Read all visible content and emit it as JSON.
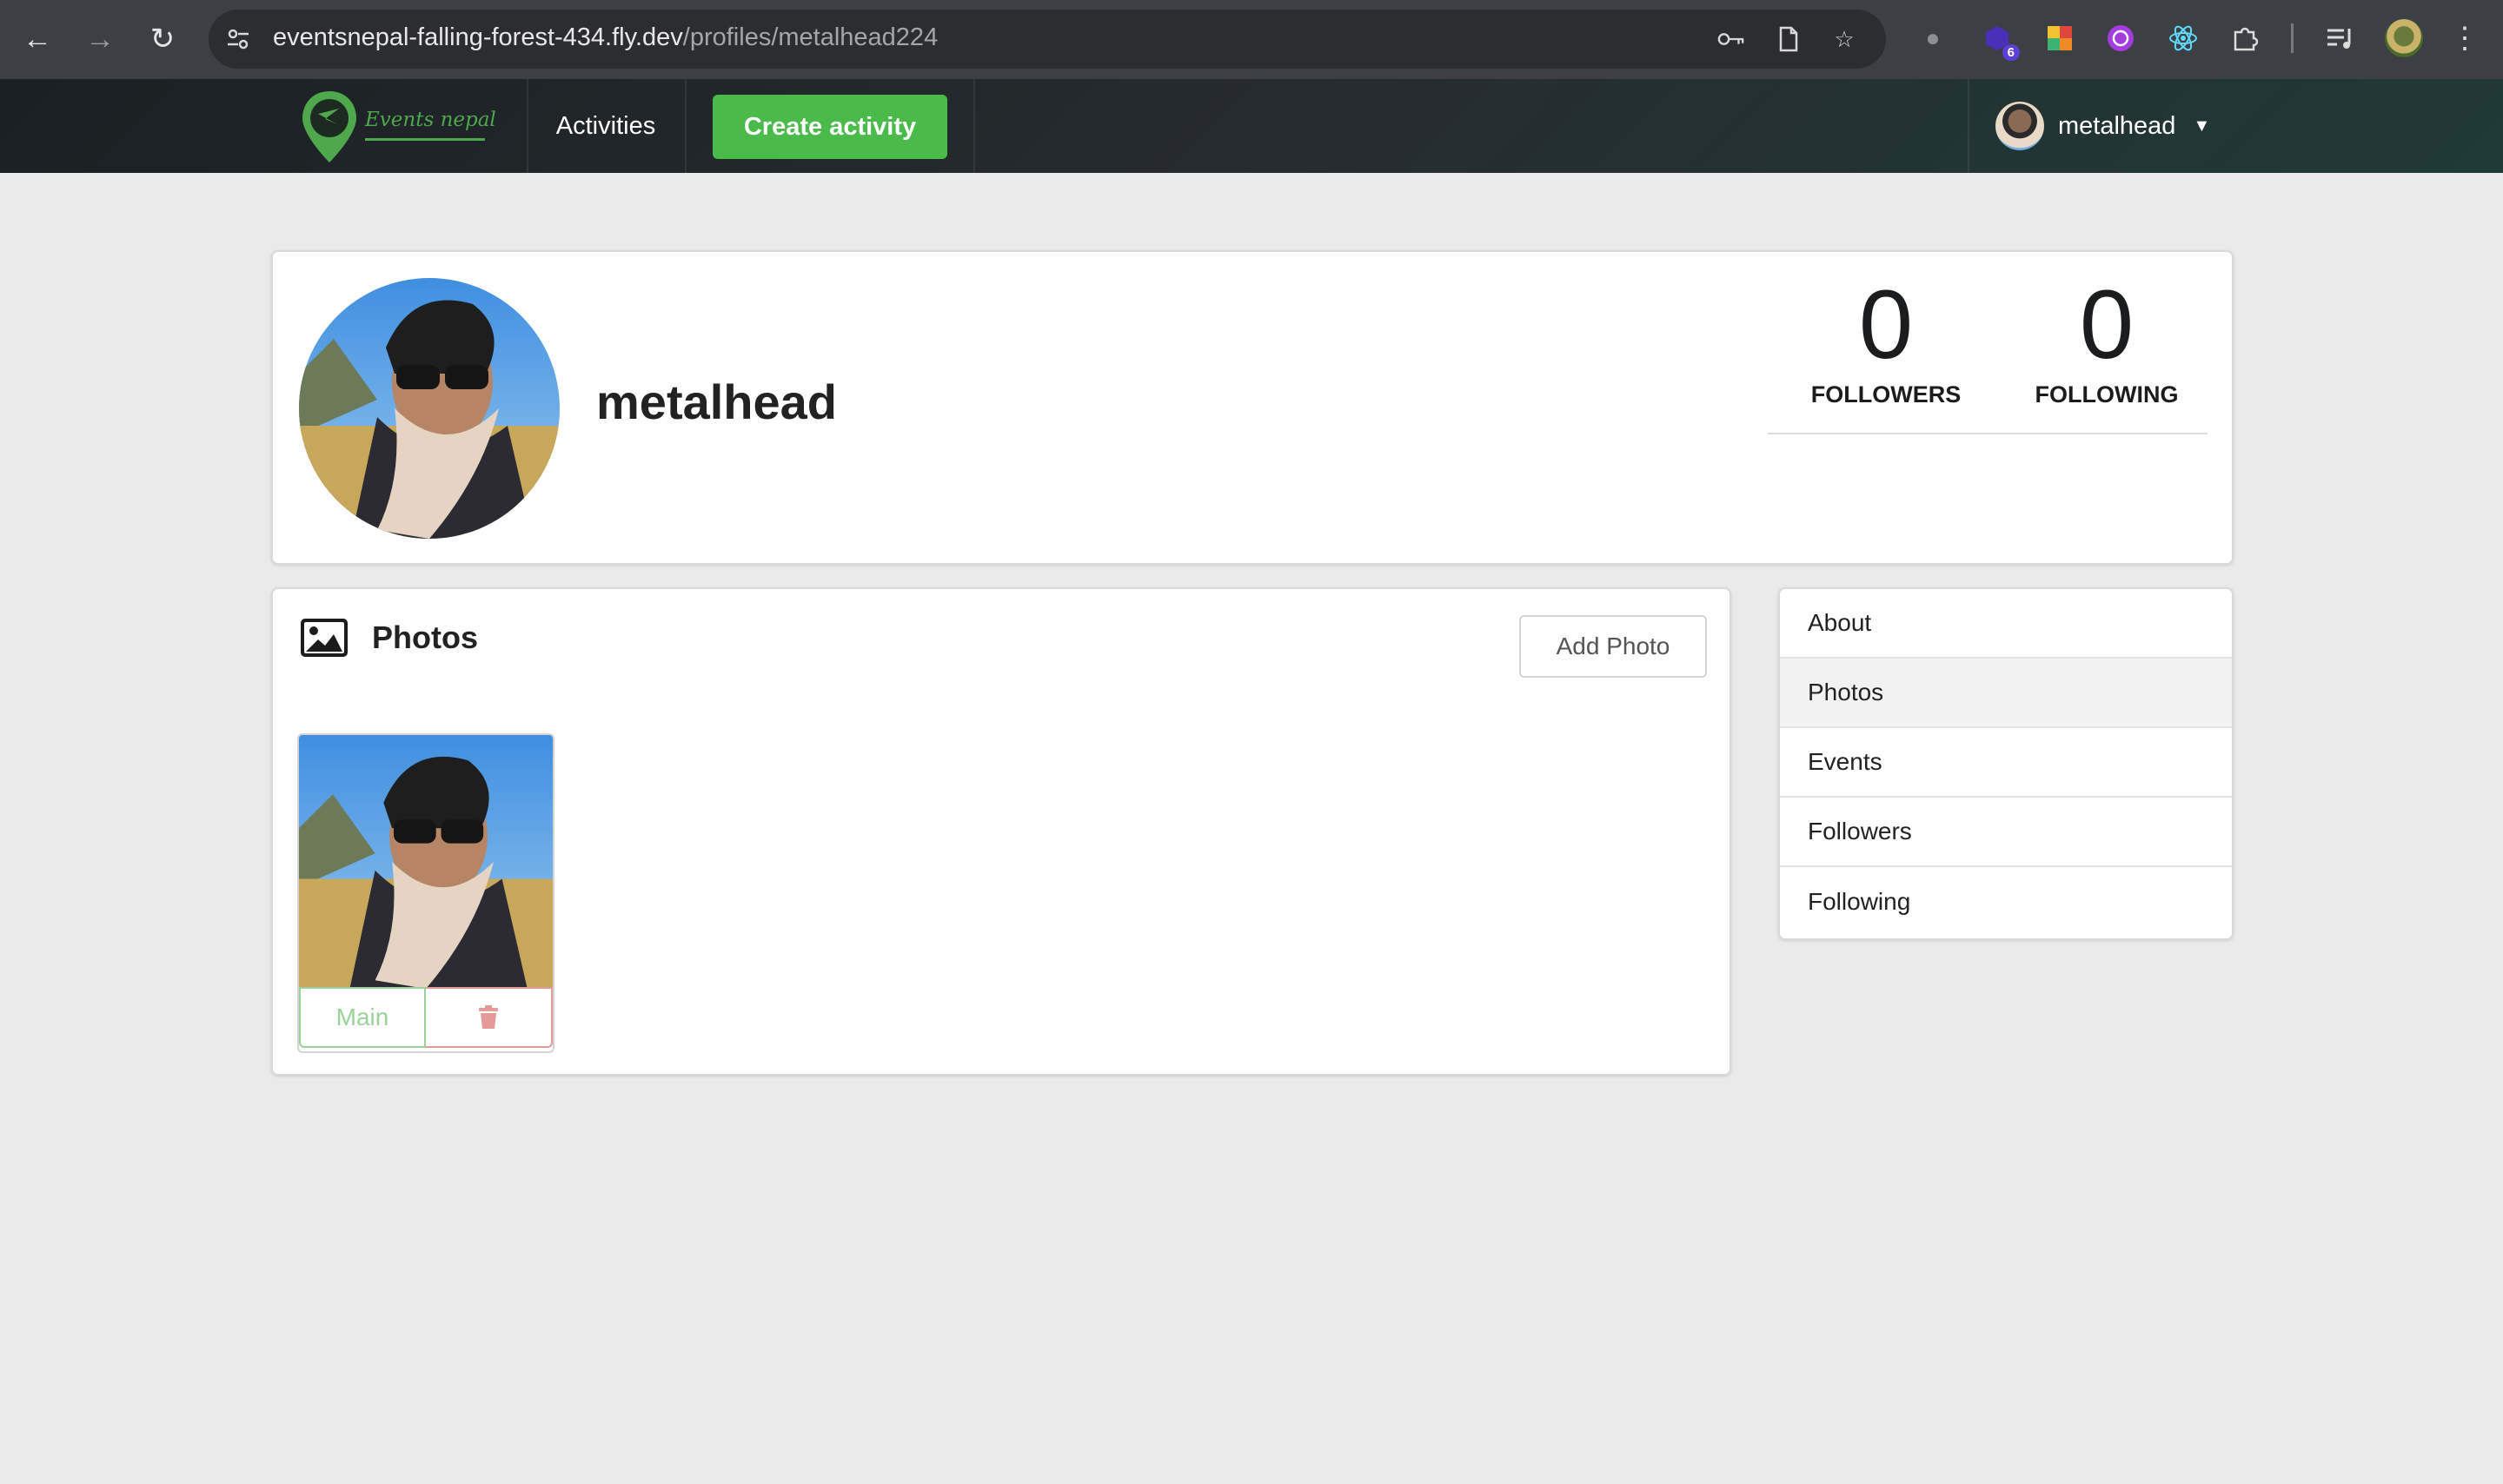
{
  "browser": {
    "url_host": "eventsnepal-falling-forest-434.fly.dev",
    "url_path": "/profiles/metalhead224",
    "extension_badge": "6"
  },
  "navbar": {
    "logo_text": "Events nepal",
    "activities_label": "Activities",
    "create_activity_label": "Create activity",
    "username": "metalhead"
  },
  "profile": {
    "display_name": "metalhead",
    "followers_count": "0",
    "followers_label": "FOLLOWERS",
    "following_count": "0",
    "following_label": "FOLLOWING"
  },
  "photos": {
    "heading": "Photos",
    "add_photo_label": "Add Photo",
    "main_label": "Main"
  },
  "side_menu": {
    "items": [
      {
        "label": "About"
      },
      {
        "label": "Photos"
      },
      {
        "label": "Events"
      },
      {
        "label": "Followers"
      },
      {
        "label": "Following"
      }
    ],
    "active": "Photos"
  },
  "colors": {
    "accent_green": "#4aba4a",
    "delete_red": "#e59a9a",
    "page_background": "#eaeaea"
  }
}
